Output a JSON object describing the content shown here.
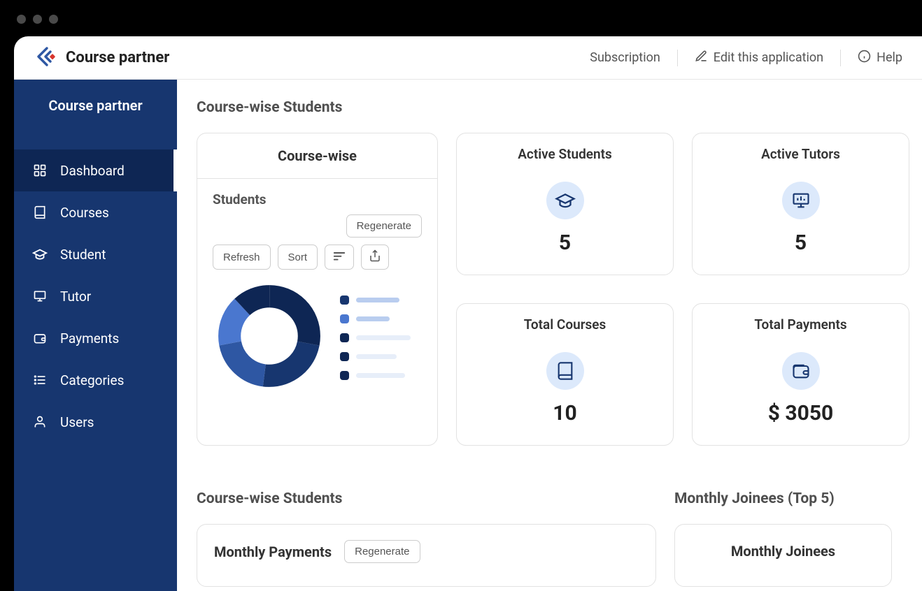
{
  "brand": {
    "name": "Course partner"
  },
  "header": {
    "subscription": "Subscription",
    "edit": "Edit this application",
    "help": "Help"
  },
  "sidebar": {
    "title": "Course partner",
    "items": [
      {
        "label": "Dashboard",
        "key": "dashboard",
        "active": true
      },
      {
        "label": "Courses",
        "key": "courses"
      },
      {
        "label": "Student",
        "key": "student"
      },
      {
        "label": "Tutor",
        "key": "tutor"
      },
      {
        "label": "Payments",
        "key": "payments"
      },
      {
        "label": "Categories",
        "key": "categories"
      },
      {
        "label": "Users",
        "key": "users"
      }
    ]
  },
  "sections": {
    "s1_title": "Course-wise Students",
    "s2_title": "Course-wise Students",
    "s3_title": "Monthly Joinees (Top 5)"
  },
  "chart_card": {
    "title": "Course-wise",
    "sub": "Students",
    "buttons": {
      "regenerate": "Regenerate",
      "refresh": "Refresh",
      "sort": "Sort"
    }
  },
  "stats": {
    "active_students": {
      "title": "Active Students",
      "value": "5"
    },
    "active_tutors": {
      "title": "Active Tutors",
      "value": "5"
    },
    "total_courses": {
      "title": "Total Courses",
      "value": "10"
    },
    "total_payments": {
      "title": "Total Payments",
      "value": "$ 3050"
    }
  },
  "bottom": {
    "monthly_payments_title": "Monthly Payments",
    "regenerate": "Regenerate",
    "monthly_joinees_title": "Monthly Joinees"
  },
  "chart_data": {
    "type": "pie",
    "title": "Course-wise Students",
    "note": "Donut chart showing distribution of students across courses. Specific per-course values are not labeled in the screenshot; legend entries are placeholder bars without text.",
    "slices": [
      {
        "color": "#0e2654",
        "approx_pct": 28
      },
      {
        "color": "#17366f",
        "approx_pct": 24
      },
      {
        "color": "#2e57a3",
        "approx_pct": 20
      },
      {
        "color": "#4a77cf",
        "approx_pct": 16
      },
      {
        "color": "#0e2654",
        "approx_pct": 12
      }
    ],
    "legend_colors": [
      "#17366f",
      "#4a77cf",
      "#0e2654",
      "#0e2654",
      "#0e2654"
    ],
    "legend_line_widths": [
      62,
      48,
      78,
      58,
      70
    ],
    "legend_line_opacity": [
      1,
      1,
      0.35,
      0.35,
      0.35
    ]
  }
}
